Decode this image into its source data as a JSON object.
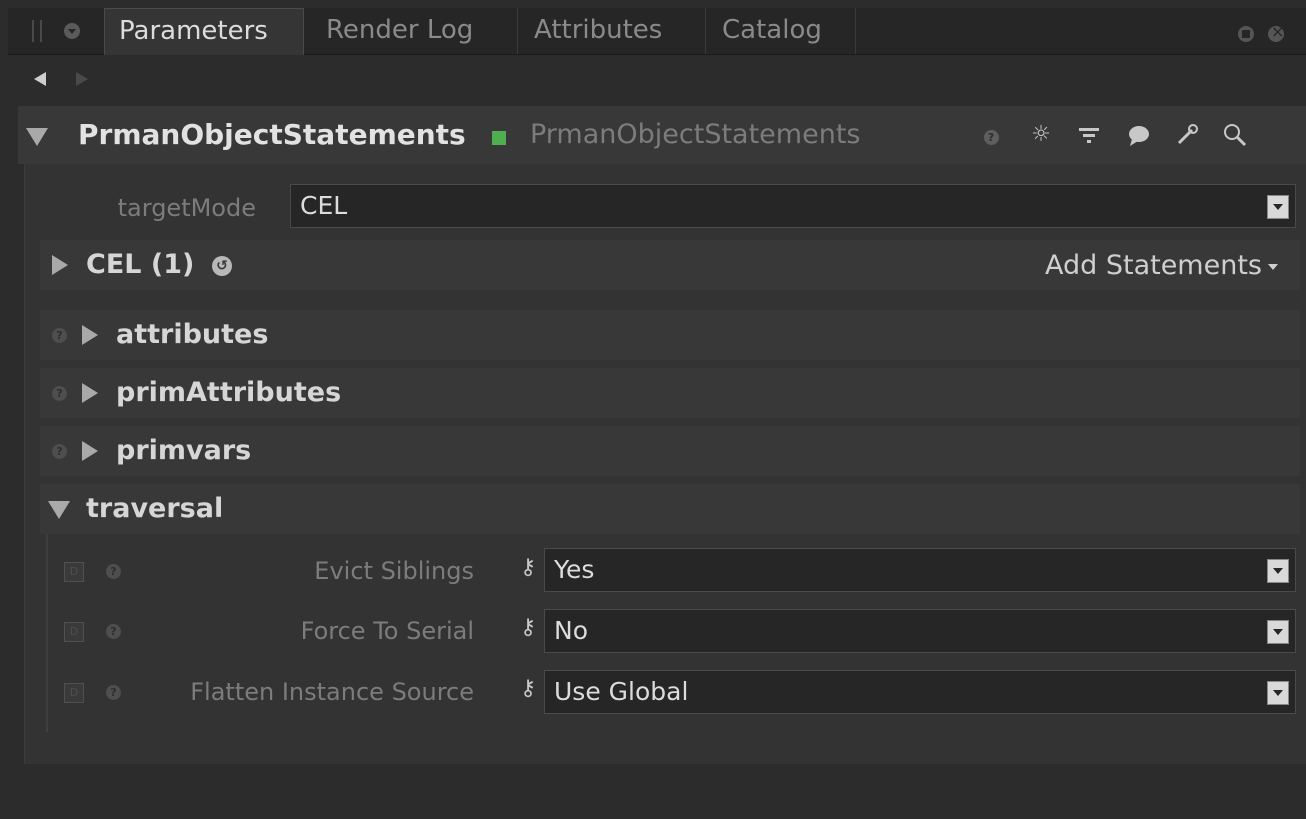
{
  "tabs": [
    "Parameters",
    "Render Log",
    "Attributes",
    "Catalog"
  ],
  "node": {
    "name": "PrmanObjectStatements",
    "type": "PrmanObjectStatements",
    "status_color": "#4fae4f"
  },
  "header_icons": [
    "help-icon",
    "gear-icon",
    "hierarchy-icon",
    "comment-icon",
    "wrench-icon",
    "search-icon"
  ],
  "targetMode": {
    "label": "targetMode",
    "value": "CEL"
  },
  "cel_group": {
    "label": "CEL (1)",
    "add_statements": "Add Statements"
  },
  "groups": [
    "attributes",
    "primAttributes",
    "primvars"
  ],
  "traversal": {
    "label": "traversal",
    "params": [
      {
        "label": "Evict Siblings",
        "value": "Yes"
      },
      {
        "label": "Force To Serial",
        "value": "No"
      },
      {
        "label": "Flatten Instance Source",
        "value": "Use Global"
      }
    ]
  },
  "help_glyph": "?",
  "d_glyph": "D",
  "key_glyph": "⚷"
}
